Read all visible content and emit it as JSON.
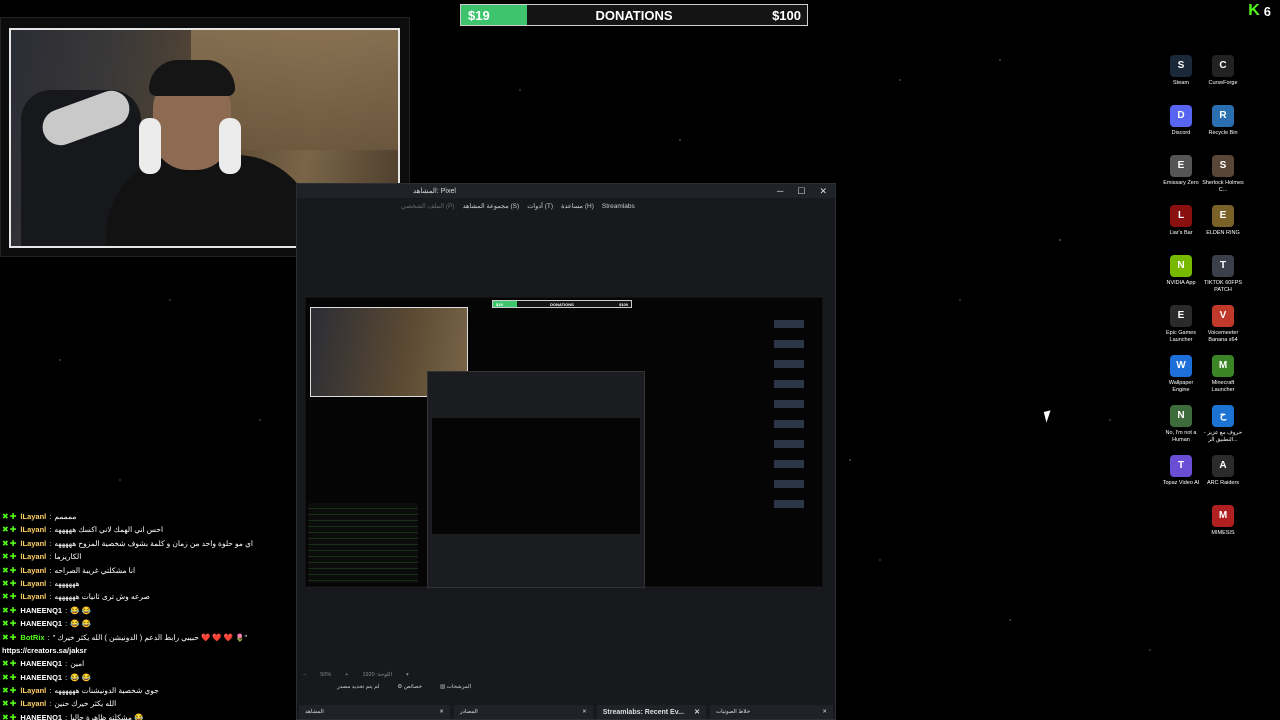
{
  "donation_bar": {
    "current": "$19",
    "title": "DONATIONS",
    "goal": "$100",
    "progress_fraction": 0.19,
    "fill_color": "#3ec46d"
  },
  "kick_badge": {
    "icon": "kick-logo",
    "count": "6"
  },
  "obs": {
    "title": "المشاهد: Pixel",
    "controls": [
      "─",
      "☐",
      "✕"
    ],
    "menu": [
      {
        "label": "الملف الشخصي (P)",
        "disabled": true
      },
      {
        "label": "مجموعة المشاهد (S)",
        "disabled": false
      },
      {
        "label": "أدوات (T)",
        "disabled": false
      },
      {
        "label": "مساعدة (H)",
        "disabled": false
      },
      {
        "label": "Streamlabs",
        "disabled": false
      }
    ],
    "preview": {
      "don_low": "$19",
      "don_title": "DONATIONS",
      "don_high": "$100"
    },
    "statusbar": [
      "−",
      "50%",
      "+",
      "اللوحة: 1920",
      "▾"
    ],
    "controls_row": [
      "لم يتم تحديد مصدر",
      "⚙ خصائص",
      "▧ المرشحات"
    ],
    "docks": [
      {
        "label": "المشاهد",
        "bold": false
      },
      {
        "label": "المصادر",
        "bold": false
      },
      {
        "label": "Streamlabs: Recent Ev...",
        "bold": true
      },
      {
        "label": "خلاط الصوتيات",
        "bold": false
      }
    ]
  },
  "chat": [
    {
      "user": "lLayanl",
      "msg": "ممممم",
      "partial": true
    },
    {
      "user": "lLayanl",
      "msg": "احس اني الهمك لاني اكسك هههههه"
    },
    {
      "user": "lLayanl",
      "msg": "اي مو حلوة واحد من زمان و كلمة بشوف شخصية المزوح هههههه"
    },
    {
      "user": "lLayanl",
      "msg": "الكاريزما"
    },
    {
      "user": "lLayanl",
      "msg": "انا مشكلتي غريبة الصراحه"
    },
    {
      "user": "lLayanl",
      "msg": "ههههههه"
    },
    {
      "user": "lLayanl",
      "msg": "صرعه وش ترى ثانيات ههههههه"
    },
    {
      "user": "HANEENQ1",
      "msg": "😂 😂"
    },
    {
      "user": "HANEENQ1",
      "msg": "😂 😂"
    },
    {
      "user": "BotRix",
      "msg": "\" حبيبي رابط الدعم ( الدونيشن ) الله يكثر خيرك ❤️ ❤️ ❤️ 🌷\""
    },
    {
      "user": "",
      "msg": "https://creators.sa/jaksr",
      "link": true
    },
    {
      "user": "HANEENQ1",
      "msg": "امين"
    },
    {
      "user": "HANEENQ1",
      "msg": "😂 😂"
    },
    {
      "user": "lLayanl",
      "msg": "جوي شخصية الدونيشنات ههههههه"
    },
    {
      "user": "lLayanl",
      "msg": "الله يكثر خيرك حنين"
    },
    {
      "user": "HANEENQ1",
      "msg": "مشكلته ظاهرة حاليا 😂"
    }
  ],
  "chat_user_colors": {
    "lLayanl": "#ffd166",
    "HANEENQ1": "#ffffff",
    "BotRix": "#53fc18"
  },
  "desktop_icons": [
    {
      "label": "Steam",
      "icon": "steam-icon",
      "color": "#1b2838"
    },
    {
      "label": "CurseForge",
      "icon": "curseforge-icon",
      "color": "#222222"
    },
    {
      "label": "Discord",
      "icon": "discord-icon",
      "color": "#5865f2"
    },
    {
      "label": "Recycle Bin",
      "icon": "recycle-bin-icon",
      "color": "#2a6fb0"
    },
    {
      "label": "Emissary Zero",
      "icon": "emissary-zero-icon",
      "color": "#555555"
    },
    {
      "label": "Sherlock Holmes C...",
      "icon": "sherlock-holmes-icon",
      "color": "#5a4636"
    },
    {
      "label": "Liar's Bar",
      "icon": "liars-bar-icon",
      "color": "#8a1010"
    },
    {
      "label": "ELDEN RING",
      "icon": "elden-ring-icon",
      "color": "#7a6128"
    },
    {
      "label": "NVIDIA App",
      "icon": "nvidia-icon",
      "color": "#76b900"
    },
    {
      "label": "TIKTOK 60FPS PATCH",
      "icon": "tiktok-patch-icon",
      "color": "#3a3f4a"
    },
    {
      "label": "Epic Games Launcher",
      "icon": "epic-games-icon",
      "color": "#2a2a2a"
    },
    {
      "label": "Voicemeeter Banana x64",
      "icon": "voicemeeter-icon",
      "color": "#c0392b"
    },
    {
      "label": "Wallpaper Engine",
      "icon": "wallpaper-engine-icon",
      "color": "#1e6fd9"
    },
    {
      "label": "Minecraft Launcher",
      "icon": "minecraft-icon",
      "color": "#3c8527"
    },
    {
      "label": "No, I'm not a Human",
      "icon": "not-a-human-icon",
      "color": "#3e6b3a"
    },
    {
      "label": "حروف مع عزيز - التطبيق الر...",
      "icon": "download-icon",
      "color": "#1b74d4"
    },
    {
      "label": "Topaz Video AI",
      "icon": "topaz-icon",
      "color": "#6a4fd6"
    },
    {
      "label": "ARC Raiders",
      "icon": "arc-raiders-icon",
      "color": "#2b2b2b"
    },
    {
      "label": "MIMESIS",
      "icon": "mimesis-icon",
      "color": "#b02020",
      "offset": true
    }
  ]
}
